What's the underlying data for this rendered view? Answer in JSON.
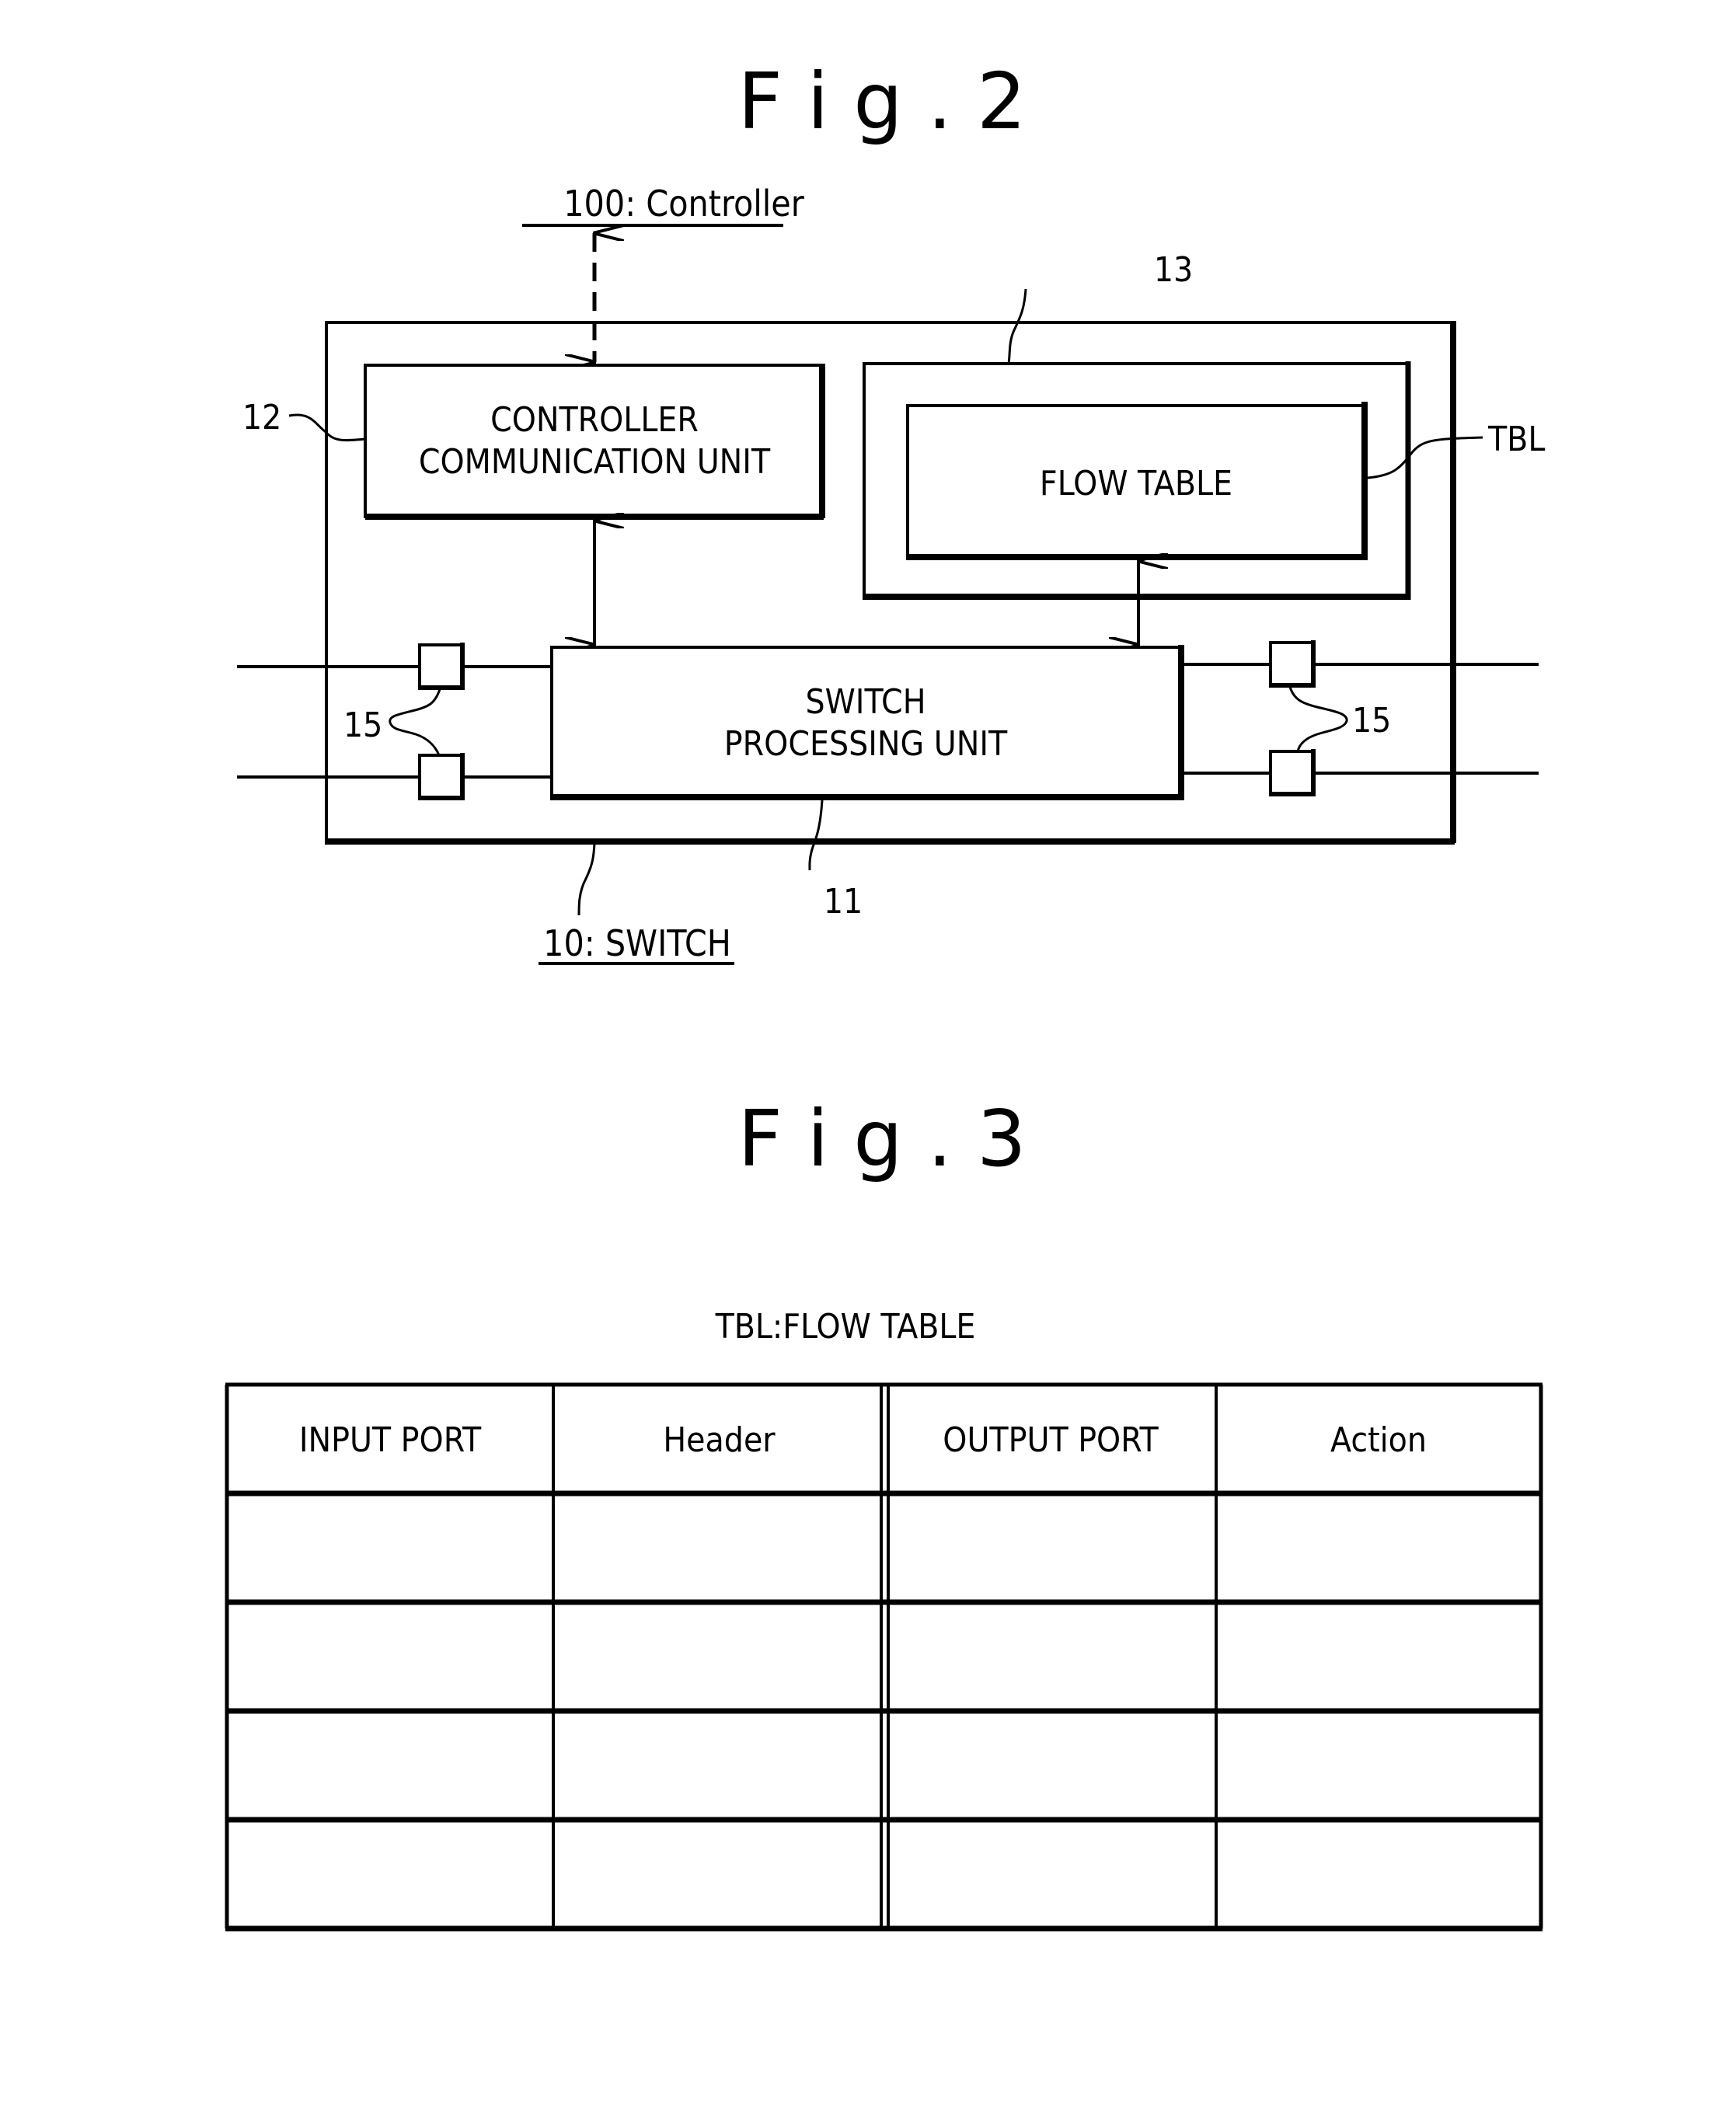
{
  "figure2": {
    "title": "F i g . 2",
    "controller_label": "100: Controller",
    "switch_label": "10: SWITCH",
    "controller_comm_unit": {
      "ref": "12",
      "line1": "CONTROLLER",
      "line2": "COMMUNICATION UNIT"
    },
    "flow_table_container": {
      "ref": "13"
    },
    "flow_table": {
      "ref": "TBL",
      "label": "FLOW TABLE"
    },
    "switch_processing_unit": {
      "ref": "11",
      "line1": "SWITCH",
      "line2": "PROCESSING UNIT"
    },
    "ports_left": {
      "ref": "15"
    },
    "ports_right": {
      "ref": "15"
    }
  },
  "figure3": {
    "title": "F i g . 3",
    "table_caption": "TBL:FLOW TABLE",
    "columns": [
      "INPUT PORT",
      "Header",
      "OUTPUT PORT",
      "Action"
    ],
    "rows": [
      [
        "",
        "",
        "",
        ""
      ],
      [
        "",
        "",
        "",
        ""
      ],
      [
        "",
        "",
        "",
        ""
      ],
      [
        "",
        "",
        "",
        ""
      ]
    ]
  }
}
